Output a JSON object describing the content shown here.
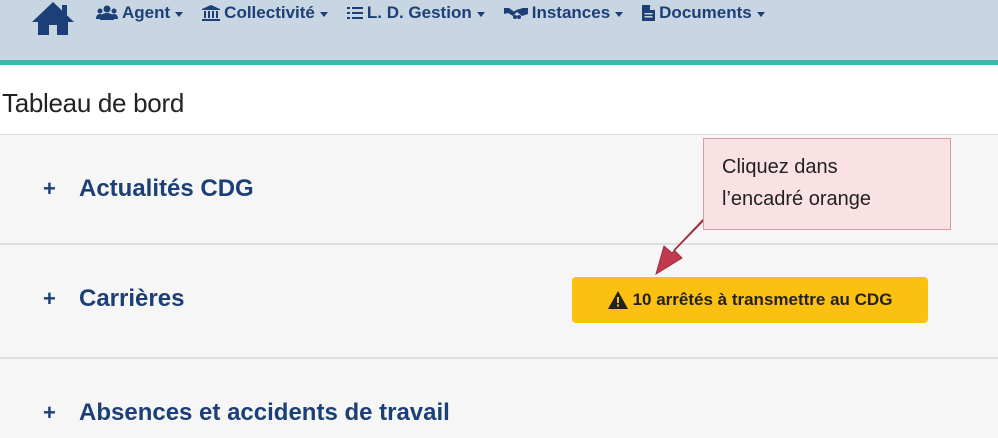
{
  "navbar": {
    "home_icon": "home-icon",
    "items": [
      {
        "label": "Agent",
        "icon": "users-icon"
      },
      {
        "label": "Collectivité",
        "icon": "institution-icon"
      },
      {
        "label": "L. D. Gestion",
        "icon": "list-icon"
      },
      {
        "label": "Instances",
        "icon": "handshake-icon"
      },
      {
        "label": "Documents",
        "icon": "file-icon"
      }
    ],
    "colors": {
      "background": "#c8d6e3",
      "accent": "#3fb7a8",
      "text": "#1d3f77"
    }
  },
  "page": {
    "title": "Tableau de bord"
  },
  "panels": [
    {
      "toggle": "+",
      "label": "Actualités CDG"
    },
    {
      "toggle": "+",
      "label": "Carrières"
    },
    {
      "toggle": "+",
      "label": "Absences et accidents de travail"
    }
  ],
  "alert": {
    "icon": "warning-icon",
    "text": "10 arrêtés à transmettre au CDG",
    "color": "#fcc010"
  },
  "callout": {
    "lines": [
      "Cliquez dans",
      "l’encadré orange"
    ],
    "color": "#f9e1e4",
    "arrow_color": "#c0394f"
  }
}
